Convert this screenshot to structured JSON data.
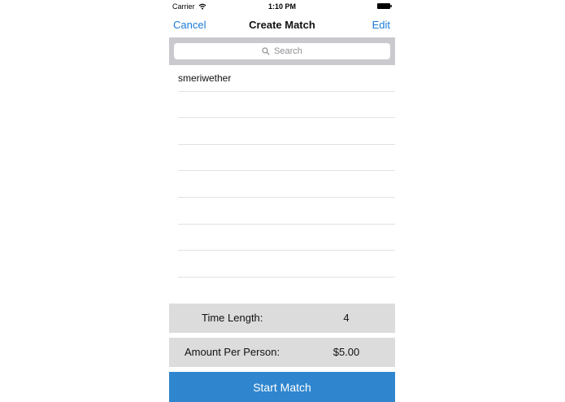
{
  "status_bar": {
    "carrier": "Carrier",
    "time": "1:10 PM"
  },
  "nav": {
    "left_label": "Cancel",
    "title": "Create Match",
    "right_label": "Edit",
    "tint_color": "#1a7ad6"
  },
  "search": {
    "placeholder": "Search",
    "icon": "search-icon"
  },
  "list": {
    "rows": [
      "smeriwether",
      "",
      "",
      "",
      "",
      "",
      "",
      "",
      ""
    ]
  },
  "settings": {
    "time_length_label": "Time Length:",
    "time_length_value": "4",
    "amount_label": "Amount Per Person:",
    "amount_value": "$5.00"
  },
  "actions": {
    "start_label": "Start Match",
    "start_color": "#2f86cf"
  }
}
